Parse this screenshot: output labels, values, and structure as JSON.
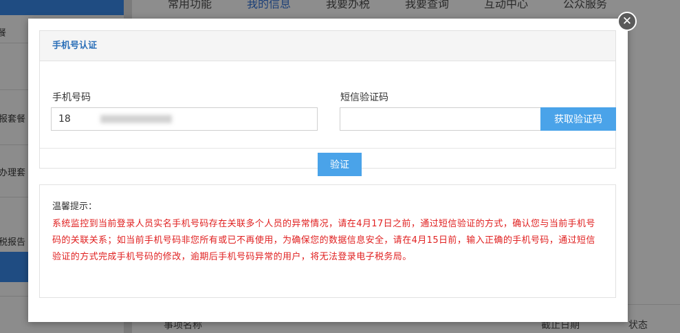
{
  "background": {
    "sidebar_items": [
      "餐",
      "报套餐",
      "办理套",
      "税报告"
    ],
    "nav_tabs": [
      "常用功能",
      "我的信息",
      "我要办税",
      "我要查询",
      "互动中心",
      "公众服务"
    ],
    "table_headers": [
      "事项名称",
      "截止日期",
      "状态"
    ]
  },
  "modal": {
    "close_icon": "close-icon",
    "panel_title": "手机号认证",
    "phone_label": "手机号码",
    "phone_value": "18",
    "sms_label": "短信验证码",
    "sms_value": "",
    "sms_button": "获取验证码",
    "verify_button": "验证",
    "notice_title": "温馨提示：",
    "notice_body": "系统监控到当前登录人员实名手机号码存在关联多个人员的异常情况，请在4月17日之前，通过短信验证的方式，确认您与当前手机号码的关联关系；如当前手机号码非您所有或已不再使用，为确保您的数据信息安全，请在4月15日前，输入正确的手机号码，通过短信验证的方式完成手机号码的修改，逾期后手机号码异常的用户，将无法登录电子税务局。"
  },
  "colors": {
    "accent": "#4aa3e9",
    "title_blue": "#2b6fb8",
    "warning_red": "#e02020"
  }
}
